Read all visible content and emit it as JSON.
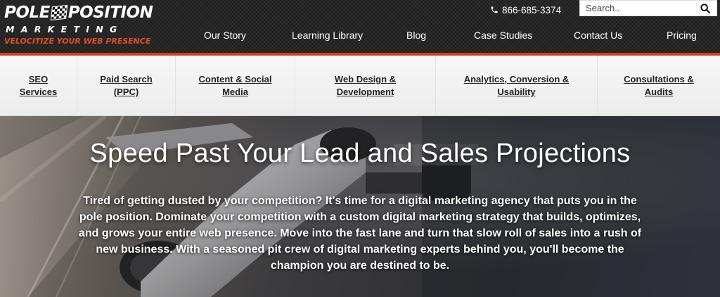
{
  "brand": {
    "logo_word1": "POLE",
    "logo_word2": "POSITION",
    "logo_line2": "MARKETING",
    "logo_tagline": "VELOCITIZE YOUR WEB PRESENCE",
    "tagline_color": "#e0501e",
    "accent_color": "#c8441a"
  },
  "header": {
    "phone_icon": "phone-icon",
    "phone": "866-685-3374",
    "search": {
      "placeholder": "Search..",
      "icon": "search-icon"
    }
  },
  "main_nav": [
    {
      "label": "Our Story"
    },
    {
      "label": "Learning Library"
    },
    {
      "label": "Blog"
    },
    {
      "label": "Case Studies"
    },
    {
      "label": "Contact Us"
    },
    {
      "label": "Pricing"
    }
  ],
  "services_nav": [
    {
      "label": "SEO Services"
    },
    {
      "label": "Paid Search (PPC)"
    },
    {
      "label": "Content & Social Media"
    },
    {
      "label": "Web Design & Development"
    },
    {
      "label": "Analytics, Conversion & Usability"
    },
    {
      "label": "Consultations & Audits"
    }
  ],
  "hero": {
    "title": "Speed Past Your Lead and Sales Projections",
    "body": "Tired of getting dusted by your competition? It's time for a digital marketing agency that puts you in the pole position. Dominate your competition with a custom digital marketing strategy that builds, optimizes, and grows your entire web presence. Move into the fast lane and turn that slow roll of sales into a rush of new business. With a seasoned pit crew of digital marketing experts behind you, you'll become the champion you are destined to be."
  }
}
